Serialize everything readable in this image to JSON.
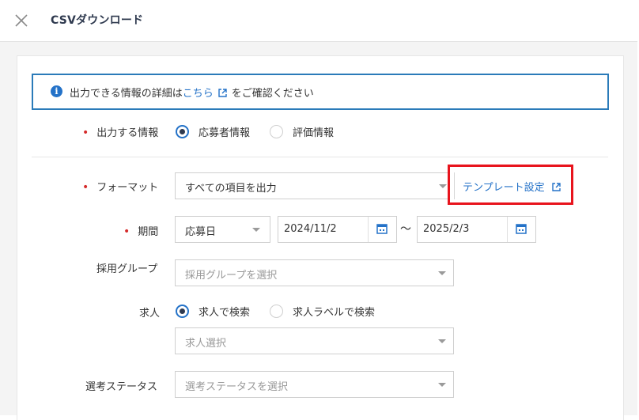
{
  "header": {
    "title": "CSVダウンロード",
    "close_icon": "close-icon"
  },
  "info": {
    "text_before": "出力できる情報の詳細は",
    "link_text": "こちら",
    "text_after": "をご確認ください",
    "icon": "info-icon"
  },
  "output_info": {
    "label": "出力する情報",
    "options": [
      {
        "label": "応募者情報",
        "selected": true
      },
      {
        "label": "評価情報",
        "selected": false
      }
    ]
  },
  "format": {
    "label": "フォーマット",
    "value": "すべての項目を出力",
    "template_link": "テンプレート設定"
  },
  "period": {
    "label": "期間",
    "type_value": "応募日",
    "start": "2024/11/2",
    "separator": "～",
    "end": "2025/2/3"
  },
  "recruit_group": {
    "label": "採用グループ",
    "placeholder": "採用グループを選択"
  },
  "job": {
    "label": "求人",
    "options": [
      {
        "label": "求人で検索",
        "selected": true
      },
      {
        "label": "求人ラベルで検索",
        "selected": false
      }
    ],
    "placeholder": "求人選択"
  },
  "selection_status": {
    "label": "選考ステータス",
    "placeholder": "選考ステータスを選択"
  },
  "colors": {
    "accent": "#2472c8",
    "required": "#d52b2b",
    "highlight": "#e8141d"
  }
}
